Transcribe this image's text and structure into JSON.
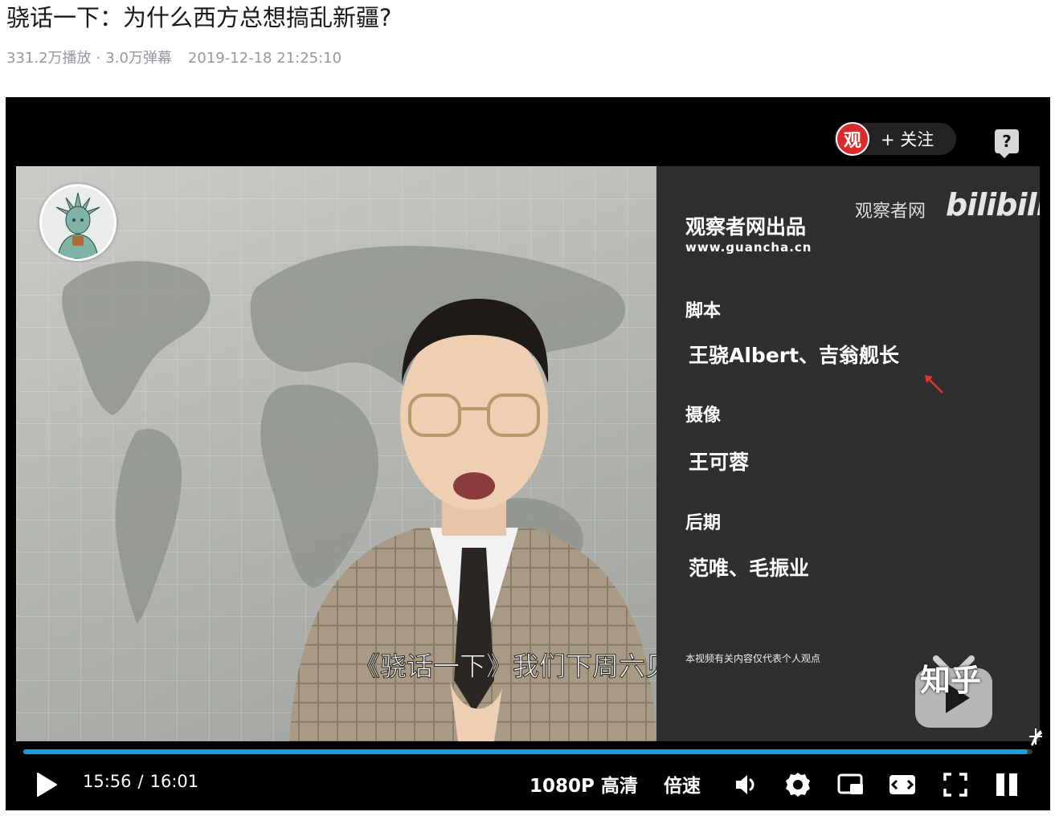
{
  "title": "骁话一下：为什么西方总想搞乱新疆?",
  "meta": {
    "plays": "331.2万播放",
    "separator": "·",
    "danmaku": "3.0万弹幕",
    "date": "2019-12-18 21:25:10"
  },
  "player": {
    "follow": {
      "logo_char": "观",
      "label": "+ 关注"
    },
    "help_label": "?",
    "subtitle": "《骁话一下》我们下周六见",
    "credits": {
      "brand": "观察者网",
      "platform": "bilibili",
      "producer": "观察者网出品",
      "url": "www.guancha.cn",
      "script_role": "脚本",
      "script_names": "王骁Albert、吉翁舰长",
      "camera_role": "摄像",
      "camera_names": "王可蓉",
      "post_role": "后期",
      "post_names": "范唯、毛振业",
      "disclaimer": "本视频有关内容仅代表个人观点"
    },
    "progress": 0.995,
    "controls": {
      "current_time": "15:56",
      "separator": "/",
      "duration": "16:01",
      "quality": "1080P 高清",
      "speed": "倍速",
      "icons": [
        "play-icon",
        "volume-icon",
        "settings-icon",
        "picture-in-picture-icon",
        "widescreen-icon",
        "fullscreen-icon"
      ]
    }
  },
  "watermark": "知乎",
  "colors": {
    "accent": "#1e9bd7",
    "follow_logo": "#d92b2b",
    "meta_text": "#9499a0"
  }
}
